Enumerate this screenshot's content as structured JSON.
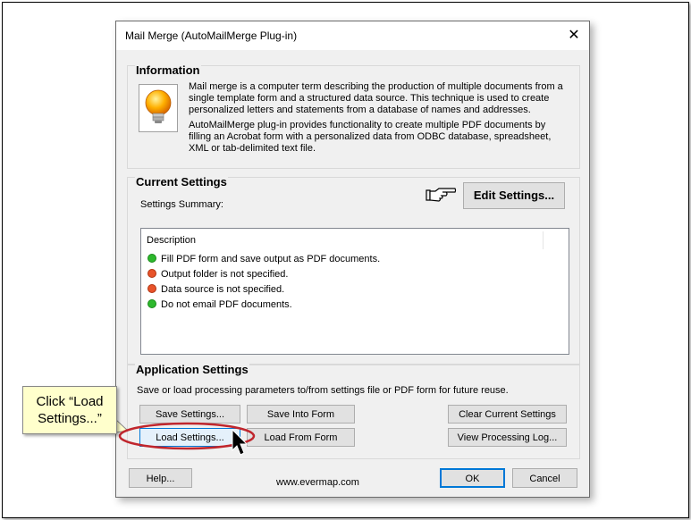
{
  "window": {
    "title": "Mail Merge (AutoMailMerge Plug-in)",
    "close_glyph": "✕"
  },
  "information": {
    "title": "Information",
    "icon": "lightbulb-icon",
    "paragraph1": "Mail merge is a computer term describing the production of multiple documents from a single template form and a structured data source. This technique is used to create personalized letters and statements from a database of names and addresses.",
    "paragraph2": "AutoMailMerge plug-in provides functionality to create multiple PDF documents by filling an Acrobat form with a personalized data from ODBC database, spreadsheet, XML or tab-delimited text file."
  },
  "current_settings": {
    "title": "Current Settings",
    "summary_label": "Settings Summary:",
    "pointer_icon": "pointing-hand-icon",
    "edit_button": "Edit Settings...",
    "list_header": "Description",
    "items": [
      {
        "text": "Fill PDF form and save output as PDF documents.",
        "status": "ok",
        "color": "#2db82d"
      },
      {
        "text": "Output folder is not specified.",
        "status": "error",
        "color": "#e8532a"
      },
      {
        "text": "Data source is not specified.",
        "status": "error",
        "color": "#e8532a"
      },
      {
        "text": "Do not email PDF documents.",
        "status": "ok",
        "color": "#2db82d"
      }
    ]
  },
  "application_settings": {
    "title": "Application Settings",
    "description": "Save or load processing parameters to/from settings file or PDF form for future reuse.",
    "save_settings": "Save Settings...",
    "save_into_form": "Save Into Form",
    "clear_settings": "Clear Current Settings",
    "load_settings": "Load Settings...",
    "load_from_form": "Load From Form",
    "view_log": "View Processing Log..."
  },
  "footer": {
    "help": "Help...",
    "website": "www.evermap.com",
    "ok": "OK",
    "cancel": "Cancel"
  },
  "callout": {
    "text": "Click “Load Settings...”",
    "highlight_color": "#c0262d"
  }
}
